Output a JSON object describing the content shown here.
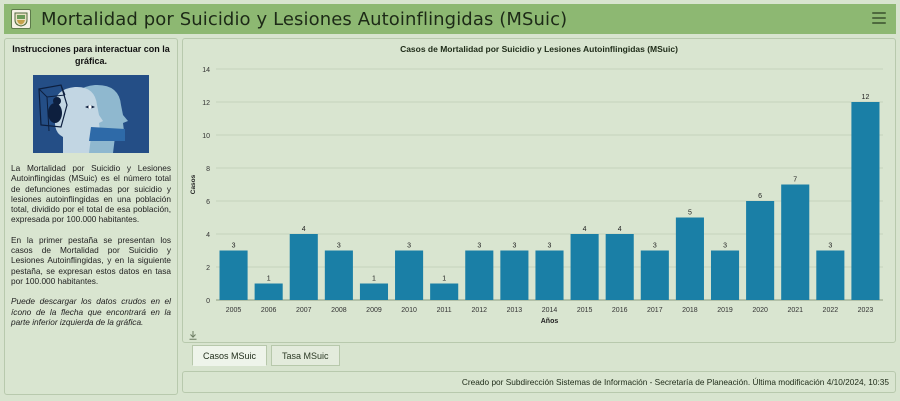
{
  "header": {
    "title": "Mortalidad por Suicidio y Lesiones Autoinflingidas (MSuic)",
    "logo_icon": "municipal-seal-icon",
    "menu_icon": "hamburger-menu-icon"
  },
  "sidebar": {
    "title": "Instrucciones para interactuar con la gráfica.",
    "paragraph1": "La Mortalidad por Suicidio y Lesiones Autoinflingidas (MSuic) es el número total de defunciones estimadas por suicidio y lesiones autoinflingidas en una población total, dividido por el total de esa población, expresada por 100.000 habitantes.",
    "paragraph2": "En la primer pestaña se presentan los casos de Mortalidad por Suicidio y Lesiones Autoinflingidas, y en la siguiente pestaña, se expresan estos datos en tasa por 100.000 habitantes.",
    "paragraph3": "Puede descargar los datos crudos en el ícono de la flecha que encontrará en la parte inferior izquierda de la gráfica."
  },
  "chart_data": {
    "type": "bar",
    "title": "Casos de Mortalidad por Suicidio y Lesiones Autoinflingidas (MSuic)",
    "xlabel": "Años",
    "ylabel": "Casos",
    "categories": [
      "2005",
      "2006",
      "2007",
      "2008",
      "2009",
      "2010",
      "2011",
      "2012",
      "2013",
      "2014",
      "2015",
      "2016",
      "2017",
      "2018",
      "2019",
      "2020",
      "2021",
      "2022",
      "2023"
    ],
    "values": [
      3,
      1,
      4,
      3,
      1,
      3,
      1,
      3,
      3,
      3,
      4,
      4,
      3,
      5,
      3,
      6,
      7,
      3,
      12
    ],
    "ylim": [
      0,
      14
    ],
    "yticks": [
      0,
      2,
      4,
      6,
      8,
      10,
      12,
      14
    ],
    "grid": true,
    "bar_color": "#1a7fa6",
    "show_data_labels": true
  },
  "tabs": [
    {
      "label": "Casos MSuic",
      "active": true
    },
    {
      "label": "Tasa MSuic",
      "active": false
    }
  ],
  "download_icon": "download-arrow-icon",
  "footer": {
    "text": "Creado por Subdirección Sistemas de Información - Secretaría de Planeación. Última modificación 4/10/2024, 10:35"
  },
  "colors": {
    "header_bg": "#8db872",
    "panel_bg": "#d9e5d0",
    "bar": "#1a7fa6"
  }
}
